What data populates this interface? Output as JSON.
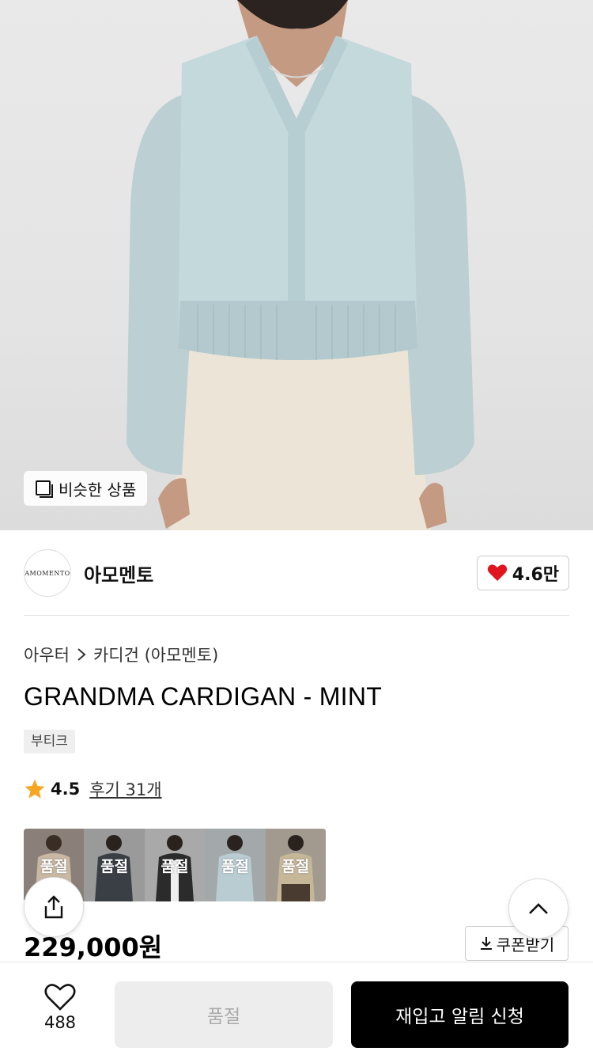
{
  "hero": {
    "similar_label": "비슷한 상품"
  },
  "brand": {
    "logo_text": "AMOMENTO",
    "name": "아모멘토",
    "like_count": "4.6만"
  },
  "breadcrumb": {
    "category": "아우터",
    "subcategory": "카디건 (아모멘토)"
  },
  "product": {
    "title": "GRANDMA CARDIGAN - MINT",
    "tag": "부티크",
    "rating": "4.5",
    "review": "후기 31개",
    "price": "229,000원"
  },
  "colors": [
    {
      "label": "품절",
      "tone": "#c9b8a3"
    },
    {
      "label": "품절",
      "tone": "#3a3f45"
    },
    {
      "label": "품절",
      "tone": "#2b2b2b"
    },
    {
      "label": "품절",
      "tone": "#b9ccd2"
    },
    {
      "label": "품절",
      "tone": "#c6b799"
    }
  ],
  "coupon": {
    "label": "쿠폰받기"
  },
  "bottom": {
    "wish_count": "488",
    "soldout_label": "품절",
    "restock_label": "재입고 알림 신청"
  },
  "theme": {
    "like_heart": "#e0151f",
    "star": "#f5a623",
    "mint": "#c4d9dc"
  }
}
